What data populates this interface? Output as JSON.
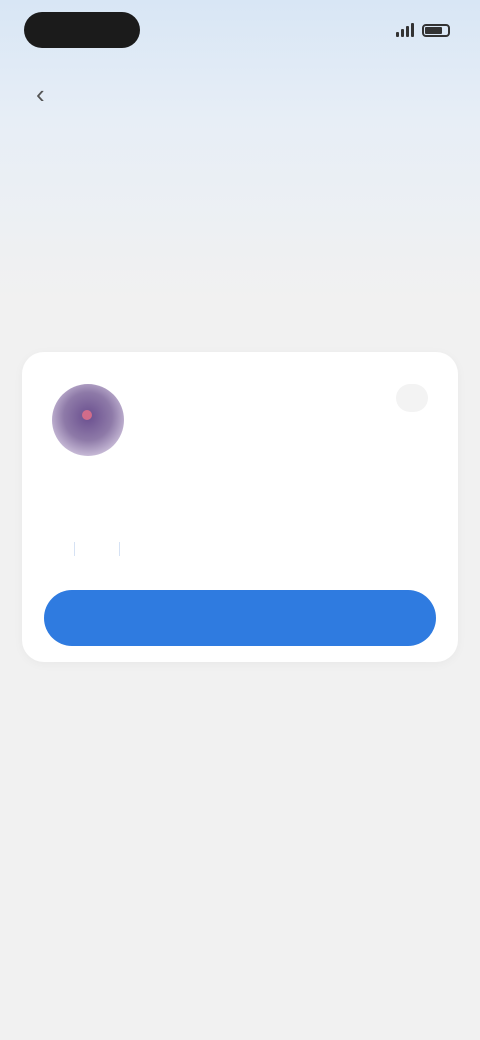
{
  "status_bar": {
    "time": "",
    "signal_icon": "signal-icon",
    "battery_icon": "battery-icon"
  },
  "nav": {
    "back_icon": "back-arrow-icon"
  },
  "intro": {
    "title": "",
    "subtitle": ""
  },
  "account_card": {
    "avatar_icon": "avatar-image",
    "tag": "",
    "name": "",
    "links": [
      "",
      "",
      ""
    ],
    "primary_button": ""
  },
  "footer": {
    "other_accounts": ""
  },
  "colors": {
    "accent": "#2f7be0",
    "link": "#3d7fe0",
    "background": "#f1f1f1",
    "card": "#ffffff"
  }
}
